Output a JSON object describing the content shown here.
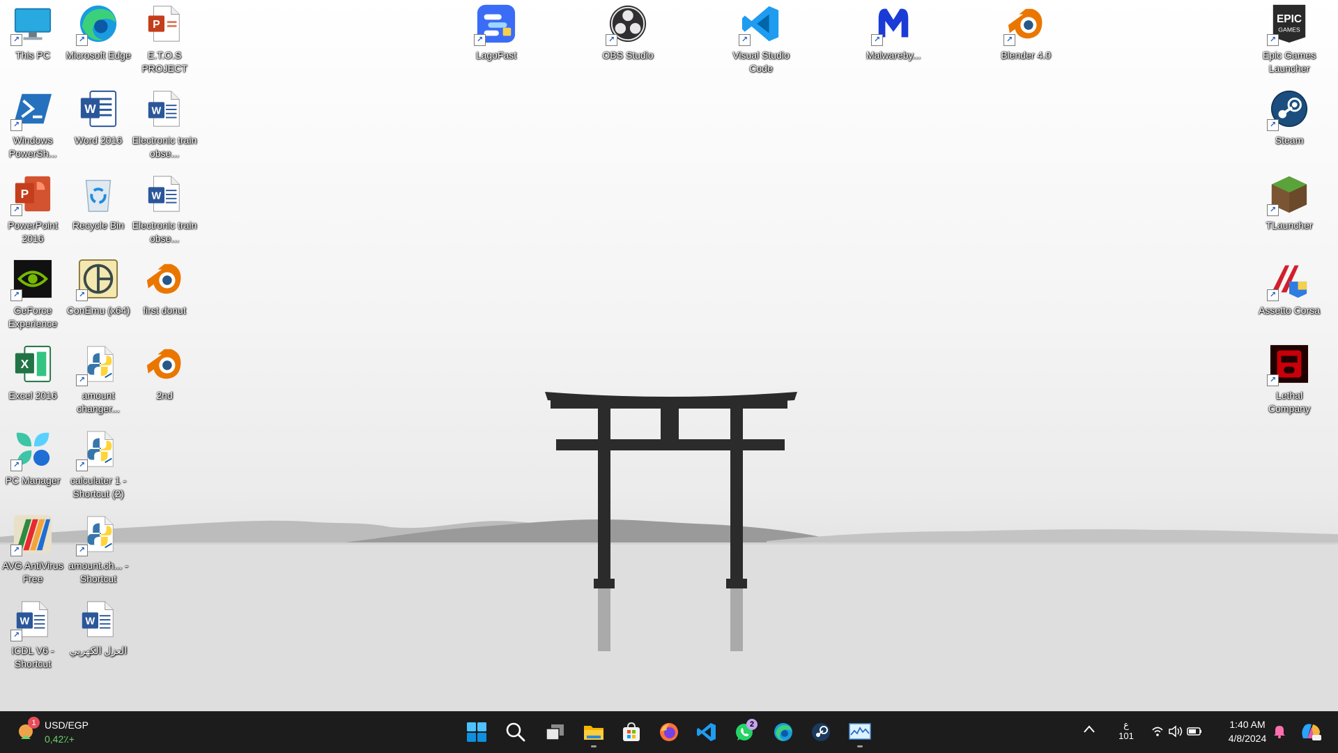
{
  "desktop": {
    "icons": [
      {
        "label": "This PC",
        "icon": "this-pc-icon"
      },
      {
        "label": "Microsoft Edge",
        "icon": "edge-icon"
      },
      {
        "label": "E.T.O.S PROJECT",
        "icon": "powerpoint-file-icon"
      },
      {
        "label": "LagoFast",
        "icon": "lagofast-icon"
      },
      {
        "label": "OBS Studio",
        "icon": "obs-icon"
      },
      {
        "label": "Visual Studio Code",
        "icon": "vscode-icon"
      },
      {
        "label": "Malwareby...",
        "icon": "malwarebytes-icon"
      },
      {
        "label": "Blender 4.0",
        "icon": "blender-icon"
      },
      {
        "label": "Epic Games Launcher",
        "icon": "epic-games-icon"
      },
      {
        "label": "Windows PowerSh...",
        "icon": "powershell-icon"
      },
      {
        "label": "Word 2016",
        "icon": "word-icon"
      },
      {
        "label": "Electronic train obse...",
        "icon": "word-file-icon"
      },
      {
        "label": "Steam",
        "icon": "steam-icon"
      },
      {
        "label": "PowerPoint 2016",
        "icon": "powerpoint-icon"
      },
      {
        "label": "Recycle Bin",
        "icon": "recycle-bin-icon"
      },
      {
        "label": "Electronic train obse...",
        "icon": "word-file-icon"
      },
      {
        "label": "TLauncher",
        "icon": "tlauncher-icon"
      },
      {
        "label": "GeForce Experience",
        "icon": "geforce-icon"
      },
      {
        "label": "ConEmu (x64)",
        "icon": "conemu-icon"
      },
      {
        "label": "first donut",
        "icon": "blender-file-icon"
      },
      {
        "label": "Assetto Corsa",
        "icon": "assetto-corsa-icon"
      },
      {
        "label": "Excel 2016",
        "icon": "excel-icon"
      },
      {
        "label": "amount changer...",
        "icon": "python-file-icon"
      },
      {
        "label": "2nd",
        "icon": "blender-file-icon"
      },
      {
        "label": "Lethal Company",
        "icon": "lethal-company-icon"
      },
      {
        "label": "PC Manager",
        "icon": "pc-manager-icon"
      },
      {
        "label": "calculater 1 - Shortcut (2)",
        "icon": "python-file-icon"
      },
      {
        "label": "AVG AntiVirus Free",
        "icon": "avg-icon"
      },
      {
        "label": "amount.ch... - Shortcut",
        "icon": "python-file-icon"
      },
      {
        "label": "ICDL V6 - Shortcut",
        "icon": "word-file-icon"
      },
      {
        "label": "العزل الكهربي",
        "icon": "word-file-icon"
      }
    ]
  },
  "taskbar": {
    "widget": {
      "title": "USD/EGP",
      "subtitle": "0,42٪+",
      "notification_count": "1"
    },
    "apps": [
      {
        "name": "start-button",
        "icon": "windows-logo-icon"
      },
      {
        "name": "search",
        "icon": "search-icon"
      },
      {
        "name": "task-view",
        "icon": "task-view-icon"
      },
      {
        "name": "file-explorer",
        "icon": "folder-icon"
      },
      {
        "name": "microsoft-store",
        "icon": "store-icon"
      },
      {
        "name": "firefox",
        "icon": "firefox-icon"
      },
      {
        "name": "vscode",
        "icon": "vscode-icon"
      },
      {
        "name": "whatsapp",
        "icon": "whatsapp-icon",
        "badge": "2"
      },
      {
        "name": "edge",
        "icon": "edge-icon"
      },
      {
        "name": "steam",
        "icon": "steam-icon"
      },
      {
        "name": "task-manager",
        "icon": "task-manager-icon"
      }
    ],
    "tray": {
      "language_top": "ع",
      "language_bottom": "101",
      "time": "1:40 AM",
      "date": "4/8/2024"
    }
  },
  "colors": {
    "taskbar_bg": "#1c1c1c",
    "accent_blue": "#0078d4",
    "badge_purple": "#c8a2f0"
  }
}
